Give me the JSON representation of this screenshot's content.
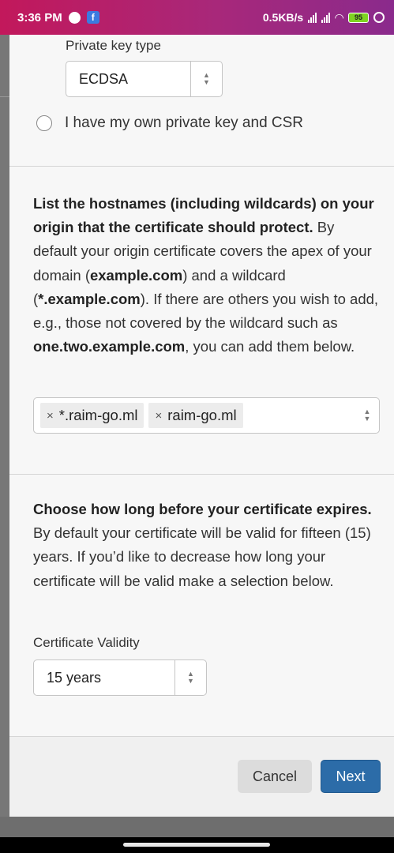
{
  "status_bar": {
    "time": "3:36 PM",
    "network_speed": "0.5KB/s",
    "battery": "95",
    "colors": {
      "gradient_start": "#c2185b",
      "gradient_end": "#8a2a8c"
    }
  },
  "key_section": {
    "private_key_type_label": "Private key type",
    "private_key_type_value": "ECDSA",
    "own_key_radio_label": "I have my own private key and CSR"
  },
  "hostnames_section": {
    "heading": "List the hostnames (including wildcards) on your origin that the certificate should protect.",
    "text_1": "By default your origin certificate covers the apex of your domain (",
    "bold_1": "example.com",
    "text_2": ") and a wildcard (",
    "bold_2": "*.example.com",
    "text_3": "). If there are others you wish to add, e.g., those not covered by the wildcard such as ",
    "bold_3": "one.two.example.com",
    "text_4": ", you can add them below.",
    "tags": [
      {
        "remove": "×",
        "label": "*.raim-go.ml"
      },
      {
        "remove": "×",
        "label": "raim-go.ml"
      }
    ]
  },
  "validity_section": {
    "heading": "Choose how long before your certificate expires.",
    "text": "By default your certificate will be valid for fifteen (15) years. If you’d like to decrease how long your certificate will be valid make a selection below.",
    "validity_label": "Certificate Validity",
    "validity_value": "15 years"
  },
  "footer": {
    "cancel_label": "Cancel",
    "next_label": "Next",
    "colors": {
      "next_bg": "#2c6ca8",
      "cancel_bg": "#dcdcdc"
    }
  },
  "icons": [
    "firefox-icon",
    "facebook-icon",
    "signal-icon",
    "wifi-icon",
    "battery-icon",
    "alarm-icon",
    "select-arrows-icon",
    "tag-remove-icon"
  ]
}
